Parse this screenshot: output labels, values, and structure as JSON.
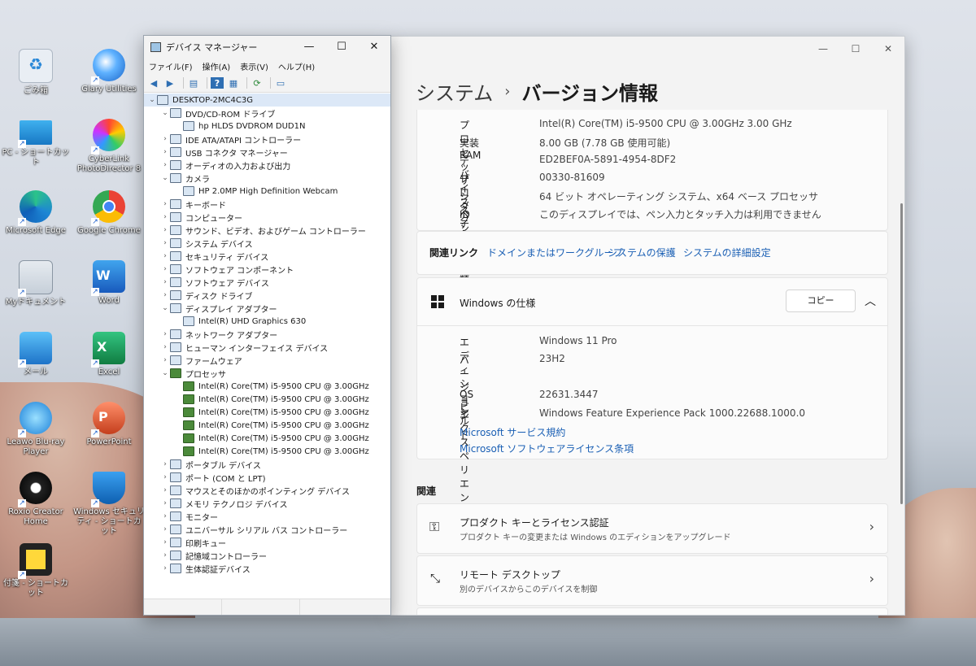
{
  "desktop": {
    "icons": [
      {
        "label": "ごみ箱",
        "icon": "recycle-bin-icon"
      },
      {
        "label": "Glary Utilities",
        "icon": "glary-icon"
      },
      {
        "label": "PC - ショートカット",
        "icon": "pc-icon"
      },
      {
        "label": "CyberLink PhotoDirector 8",
        "icon": "photodirector-icon"
      },
      {
        "label": "Microsoft Edge",
        "icon": "edge-icon"
      },
      {
        "label": "Google Chrome",
        "icon": "chrome-icon"
      },
      {
        "label": "Myドキュメント",
        "icon": "documents-icon"
      },
      {
        "label": "Word",
        "icon": "word-icon"
      },
      {
        "label": "メール",
        "icon": "mail-icon"
      },
      {
        "label": "Excel",
        "icon": "excel-icon"
      },
      {
        "label": "Leawo Blu-ray Player",
        "icon": "bluray-icon"
      },
      {
        "label": "PowerPoint",
        "icon": "powerpoint-icon"
      },
      {
        "label": "Roxio Creator Home",
        "icon": "roxio-icon"
      },
      {
        "label": "Windows セキュリティ - ショートカット",
        "icon": "security-icon"
      },
      {
        "label": "付箋 - ショートカット",
        "icon": "sticky-notes-icon"
      }
    ]
  },
  "device_manager": {
    "title": "デバイス マネージャー",
    "menu": [
      "ファイル(F)",
      "操作(A)",
      "表示(V)",
      "ヘルプ(H)"
    ],
    "tree": [
      {
        "label": "DESKTOP-2MC4C3G",
        "level": 0,
        "expander": "v",
        "root": true
      },
      {
        "label": "DVD/CD-ROM ドライブ",
        "level": 1,
        "expander": "v"
      },
      {
        "label": "hp HLDS DVDROM DUD1N",
        "level": 2,
        "expander": ""
      },
      {
        "label": "IDE ATA/ATAPI コントローラー",
        "level": 1,
        "expander": ">"
      },
      {
        "label": "USB コネクタ マネージャー",
        "level": 1,
        "expander": ">"
      },
      {
        "label": "オーディオの入力および出力",
        "level": 1,
        "expander": ">"
      },
      {
        "label": "カメラ",
        "level": 1,
        "expander": "v"
      },
      {
        "label": "HP 2.0MP High Definition Webcam",
        "level": 2,
        "expander": ""
      },
      {
        "label": "キーボード",
        "level": 1,
        "expander": ">"
      },
      {
        "label": "コンピューター",
        "level": 1,
        "expander": ">"
      },
      {
        "label": "サウンド、ビデオ、およびゲーム コントローラー",
        "level": 1,
        "expander": ">"
      },
      {
        "label": "システム デバイス",
        "level": 1,
        "expander": ">"
      },
      {
        "label": "セキュリティ デバイス",
        "level": 1,
        "expander": ">"
      },
      {
        "label": "ソフトウェア コンポーネント",
        "level": 1,
        "expander": ">"
      },
      {
        "label": "ソフトウェア デバイス",
        "level": 1,
        "expander": ">"
      },
      {
        "label": "ディスク ドライブ",
        "level": 1,
        "expander": ">"
      },
      {
        "label": "ディスプレイ アダプター",
        "level": 1,
        "expander": "v"
      },
      {
        "label": "Intel(R) UHD Graphics 630",
        "level": 2,
        "expander": ""
      },
      {
        "label": "ネットワーク アダプター",
        "level": 1,
        "expander": ">"
      },
      {
        "label": "ヒューマン インターフェイス デバイス",
        "level": 1,
        "expander": ">"
      },
      {
        "label": "ファームウェア",
        "level": 1,
        "expander": ">"
      },
      {
        "label": "プロセッサ",
        "level": 1,
        "expander": "v",
        "proc": true
      },
      {
        "label": "Intel(R) Core(TM) i5-9500 CPU @ 3.00GHz",
        "level": 2,
        "expander": "",
        "proc": true
      },
      {
        "label": "Intel(R) Core(TM) i5-9500 CPU @ 3.00GHz",
        "level": 2,
        "expander": "",
        "proc": true
      },
      {
        "label": "Intel(R) Core(TM) i5-9500 CPU @ 3.00GHz",
        "level": 2,
        "expander": "",
        "proc": true
      },
      {
        "label": "Intel(R) Core(TM) i5-9500 CPU @ 3.00GHz",
        "level": 2,
        "expander": "",
        "proc": true
      },
      {
        "label": "Intel(R) Core(TM) i5-9500 CPU @ 3.00GHz",
        "level": 2,
        "expander": "",
        "proc": true
      },
      {
        "label": "Intel(R) Core(TM) i5-9500 CPU @ 3.00GHz",
        "level": 2,
        "expander": "",
        "proc": true
      },
      {
        "label": "ポータブル デバイス",
        "level": 1,
        "expander": ">"
      },
      {
        "label": "ポート (COM と LPT)",
        "level": 1,
        "expander": ">"
      },
      {
        "label": "マウスとそのほかのポインティング デバイス",
        "level": 1,
        "expander": ">"
      },
      {
        "label": "メモリ テクノロジ デバイス",
        "level": 1,
        "expander": ">"
      },
      {
        "label": "モニター",
        "level": 1,
        "expander": ">"
      },
      {
        "label": "ユニバーサル シリアル バス コントローラー",
        "level": 1,
        "expander": ">"
      },
      {
        "label": "印刷キュー",
        "level": 1,
        "expander": ">"
      },
      {
        "label": "記憶域コントローラー",
        "level": 1,
        "expander": ">"
      },
      {
        "label": "生体認証デバイス",
        "level": 1,
        "expander": ">"
      }
    ]
  },
  "settings": {
    "breadcrumb": {
      "parent": "システム",
      "separator": "›",
      "current": "バージョン情報"
    },
    "device_specs": [
      {
        "key": "プロセッサ",
        "value": "Intel(R) Core(TM) i5-9500 CPU @ 3.00GHz   3.00 GHz"
      },
      {
        "key": "実装 RAM",
        "value": "8.00 GB (7.78 GB 使用可能)"
      },
      {
        "key": "デバイス ID",
        "value": "ED2BEF0A-5891-4954-8DF2"
      },
      {
        "key": "プロダクト ID",
        "value": "00330-81609"
      },
      {
        "key": "システムの種類",
        "value": "64 ビット オペレーティング システム、x64 ベース プロセッサ"
      },
      {
        "key": "ペンとタッチ",
        "value": "このディスプレイでは、ペン入力とタッチ入力は利用できません"
      }
    ],
    "related_links": {
      "label": "関連リンク",
      "links": [
        "ドメインまたはワークグループ",
        "システムの保護",
        "システムの詳細設定"
      ]
    },
    "windows_spec": {
      "title": "Windows の仕様",
      "copy_label": "コピー",
      "rows_a": [
        {
          "key": "エディション",
          "value": "Windows 11 Pro"
        },
        {
          "key": "バージョン",
          "value": "23H2"
        }
      ],
      "rows_b": [
        {
          "key": "OS ビルド",
          "value": "22631.3447"
        },
        {
          "key": "エクスペリエンス",
          "value": "Windows Feature Experience Pack 1000.22688.1000.0"
        }
      ],
      "links": [
        "Microsoft サービス規約",
        "Microsoft ソフトウェアライセンス条項"
      ]
    },
    "related": {
      "heading": "関連",
      "items": [
        {
          "title": "プロダクト キーとライセンス認証",
          "subtitle": "プロダクト キーの変更または Windows のエディションをアップグレード",
          "icon": "key-icon"
        },
        {
          "title": "リモート デスクトップ",
          "subtitle": "別のデバイスからこのデバイスを制御",
          "icon": "remote-desktop-icon"
        }
      ]
    }
  },
  "colors": {
    "accent": "#1a5fb4",
    "selected_row": "#dce8f7"
  }
}
